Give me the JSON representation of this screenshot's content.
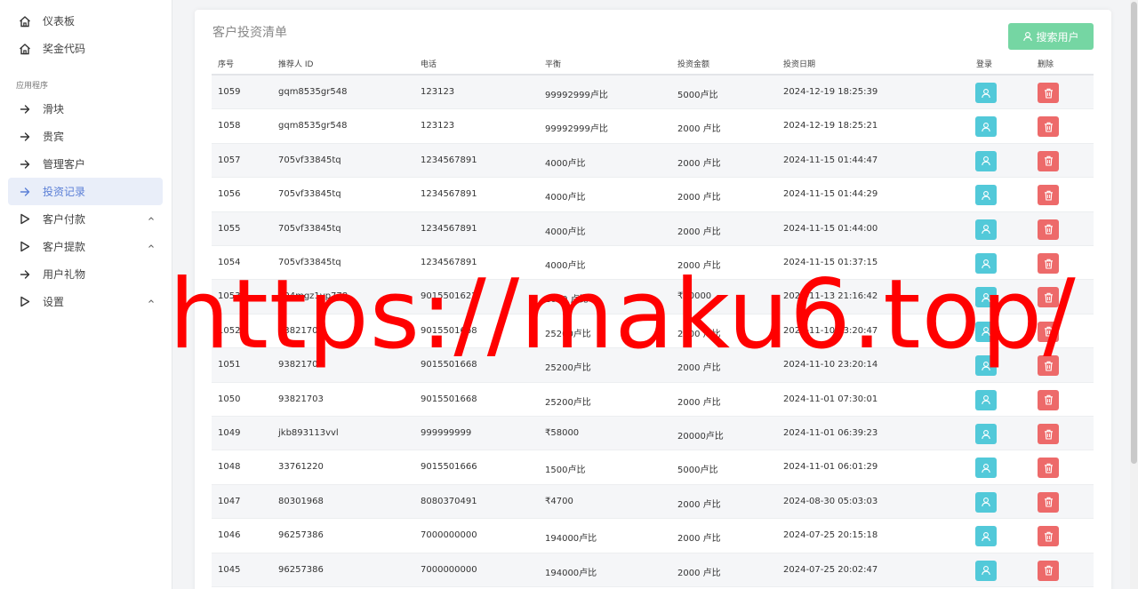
{
  "sidebar": {
    "top_items": [
      {
        "label": "仪表板",
        "icon": "home-icon"
      },
      {
        "label": "奖金代码",
        "icon": "home-icon"
      }
    ],
    "section_label": "应用程序",
    "app_items": [
      {
        "label": "滑块",
        "icon": "arrow-right-icon",
        "active": false,
        "chevron": false
      },
      {
        "label": "贵宾",
        "icon": "arrow-right-icon",
        "active": false,
        "chevron": false
      },
      {
        "label": "管理客户",
        "icon": "arrow-right-icon",
        "active": false,
        "chevron": false
      },
      {
        "label": "投资记录",
        "icon": "arrow-right-icon",
        "active": true,
        "chevron": false
      },
      {
        "label": "客户付款",
        "icon": "play-icon",
        "active": false,
        "chevron": true
      },
      {
        "label": "客户提款",
        "icon": "play-icon",
        "active": false,
        "chevron": true
      },
      {
        "label": "用户礼物",
        "icon": "arrow-right-icon",
        "active": false,
        "chevron": false
      },
      {
        "label": "设置",
        "icon": "play-icon",
        "active": false,
        "chevron": true
      }
    ]
  },
  "card": {
    "title": "客户投资清单",
    "search_button_label": "搜索用户"
  },
  "table": {
    "headers": [
      "序号",
      "推荐人 ID",
      "电话",
      "平衡",
      "投资金额",
      "投资日期",
      "登录",
      "删除"
    ],
    "rows": [
      [
        "1059",
        "gqm8535gr548",
        "123123",
        "99992999卢比",
        "5000卢比",
        "2024-12-19 18:25:39"
      ],
      [
        "1058",
        "gqm8535gr548",
        "123123",
        "99992999卢比",
        "2000 卢比",
        "2024-12-19 18:25:21"
      ],
      [
        "1057",
        "705vf33845tq",
        "1234567891",
        "4000卢比",
        "2000 卢比",
        "2024-11-15 01:44:47"
      ],
      [
        "1056",
        "705vf33845tq",
        "1234567891",
        "4000卢比",
        "2000 卢比",
        "2024-11-15 01:44:29"
      ],
      [
        "1055",
        "705vf33845tq",
        "1234567891",
        "4000卢比",
        "2000 卢比",
        "2024-11-15 01:44:00"
      ],
      [
        "1054",
        "705vf33845tq",
        "1234567891",
        "4000卢比",
        "2000 卢比",
        "2024-11-15 01:37:15"
      ],
      [
        "1053",
        "804mgz1vp778",
        "9015501622",
        "2000 卢比",
        "₹10000",
        "2024-11-13 21:16:42"
      ],
      [
        "1052",
        "93821703",
        "9015501668",
        "25200卢比",
        "2000 卢比",
        "2024-11-10 23:20:47"
      ],
      [
        "1051",
        "93821703",
        "9015501668",
        "25200卢比",
        "2000 卢比",
        "2024-11-10 23:20:14"
      ],
      [
        "1050",
        "93821703",
        "9015501668",
        "25200卢比",
        "2000 卢比",
        "2024-11-01 07:30:01"
      ],
      [
        "1049",
        "jkb893113vvl",
        "999999999",
        "₹58000",
        "20000卢比",
        "2024-11-01 06:39:23"
      ],
      [
        "1048",
        "33761220",
        "9015501666",
        "1500卢比",
        "5000卢比",
        "2024-11-01 06:01:29"
      ],
      [
        "1047",
        "80301968",
        "8080370491",
        "₹4700",
        "2000 卢比",
        "2024-08-30 05:03:03"
      ],
      [
        "1046",
        "96257386",
        "7000000000",
        "194000卢比",
        "2000 卢比",
        "2024-07-25 20:15:18"
      ],
      [
        "1045",
        "96257386",
        "7000000000",
        "194000卢比",
        "2000 卢比",
        "2024-07-25 20:02:47"
      ]
    ]
  },
  "watermark": "https://maku6.top/",
  "colors": {
    "accent_active": "#5b7fd6",
    "search_button": "#75d6a3",
    "login_button": "#52c9d9",
    "delete_button": "#ed6a6a",
    "watermark": "#ff0000"
  }
}
